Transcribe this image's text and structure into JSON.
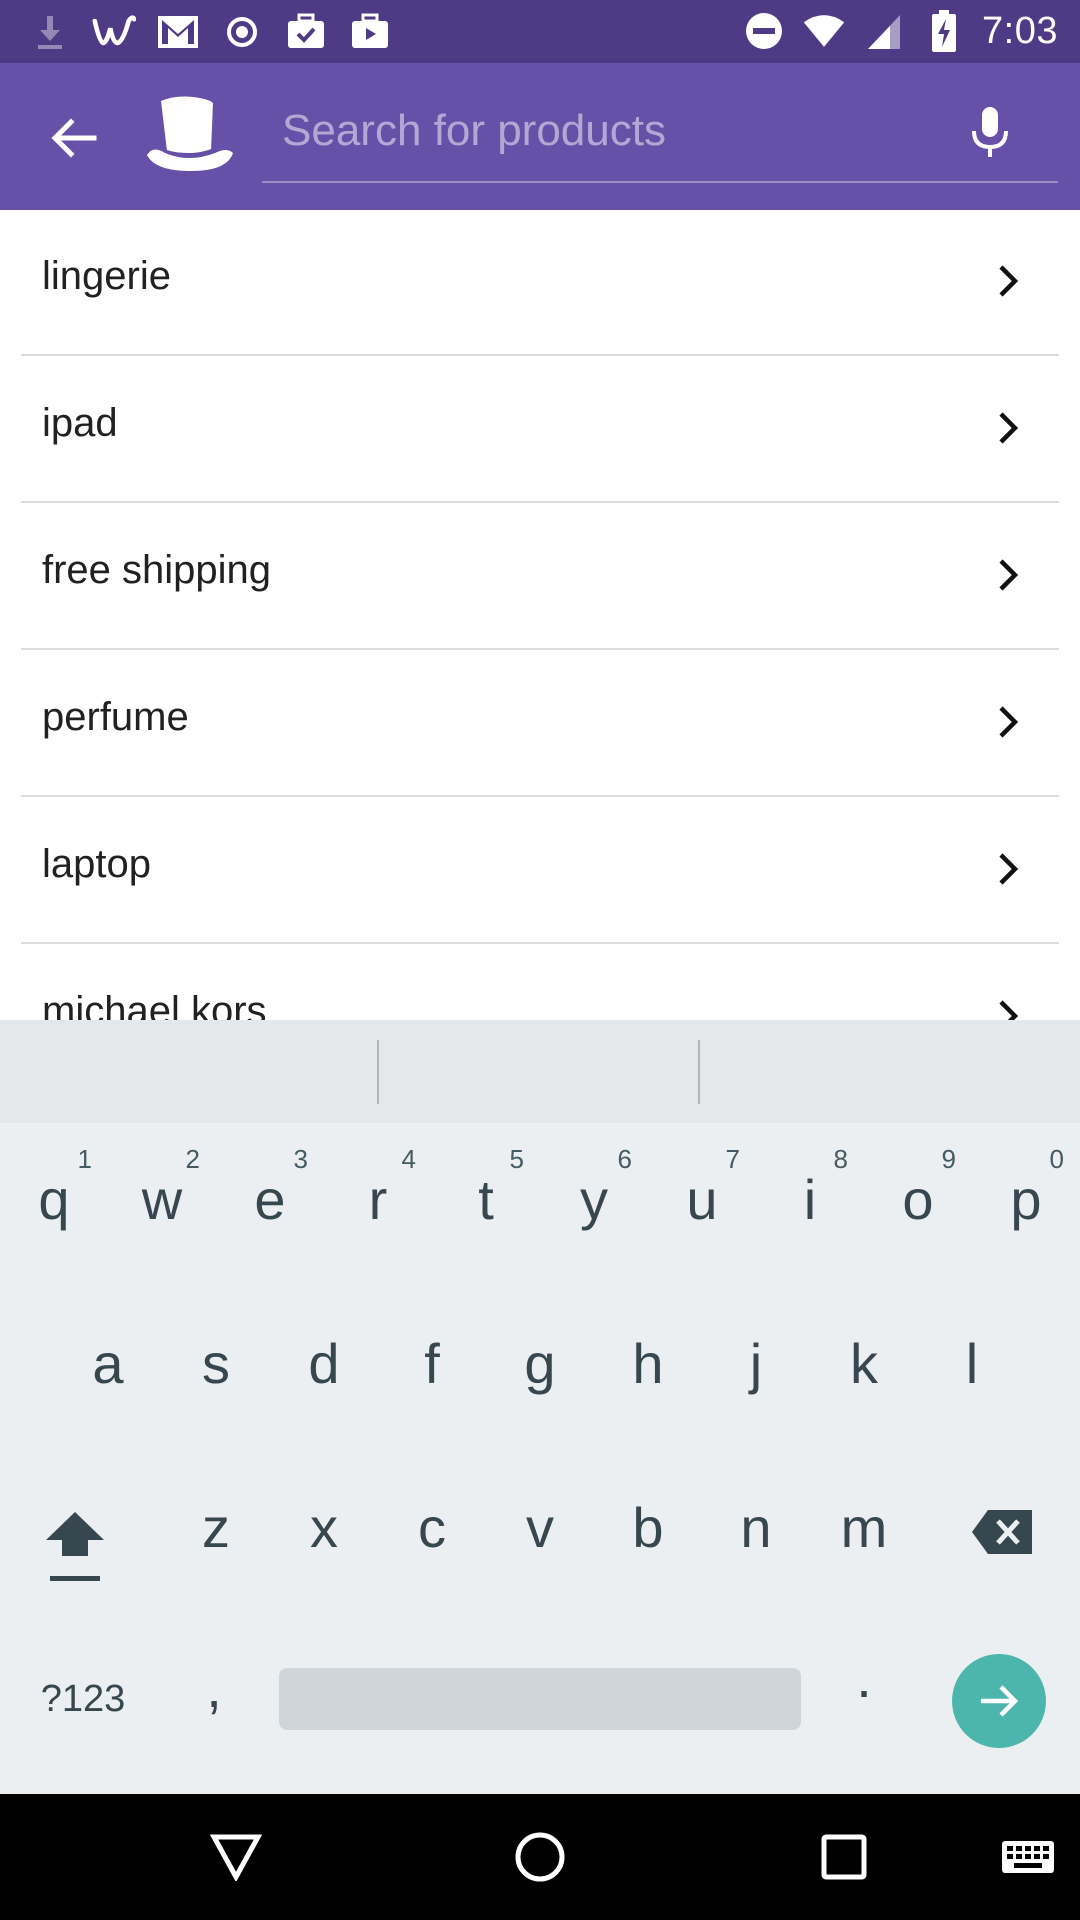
{
  "status_bar": {
    "time": "7:03",
    "left_icons": [
      "download-icon",
      "wish-w-icon",
      "gmail-icon",
      "record-icon",
      "briefcase-check-icon",
      "briefcase-play-icon"
    ],
    "right_icons": [
      "do-not-disturb-icon",
      "wifi-icon",
      "signal-icon",
      "battery-charging-icon"
    ]
  },
  "app_bar": {
    "background": "#6650a8",
    "search": {
      "placeholder": "Search for products",
      "value": ""
    }
  },
  "suggestions": [
    {
      "label": "lingerie"
    },
    {
      "label": "ipad"
    },
    {
      "label": "free shipping"
    },
    {
      "label": "perfume"
    },
    {
      "label": "laptop"
    },
    {
      "label": "michael kors"
    }
  ],
  "keyboard": {
    "row1": [
      {
        "key": "q",
        "hint": "1"
      },
      {
        "key": "w",
        "hint": "2"
      },
      {
        "key": "e",
        "hint": "3"
      },
      {
        "key": "r",
        "hint": "4"
      },
      {
        "key": "t",
        "hint": "5"
      },
      {
        "key": "y",
        "hint": "6"
      },
      {
        "key": "u",
        "hint": "7"
      },
      {
        "key": "i",
        "hint": "8"
      },
      {
        "key": "o",
        "hint": "9"
      },
      {
        "key": "p",
        "hint": "0"
      }
    ],
    "row2": [
      "a",
      "s",
      "d",
      "f",
      "g",
      "h",
      "j",
      "k",
      "l"
    ],
    "row3": [
      "z",
      "x",
      "c",
      "v",
      "b",
      "n",
      "m"
    ],
    "symbols_label": "?123",
    "comma": ",",
    "period": ".",
    "enter_color": "#4db6ac"
  },
  "nav_bar": {
    "buttons": [
      "back-triangle-icon",
      "home-circle-icon",
      "recents-square-icon",
      "keyboard-switch-icon"
    ]
  }
}
